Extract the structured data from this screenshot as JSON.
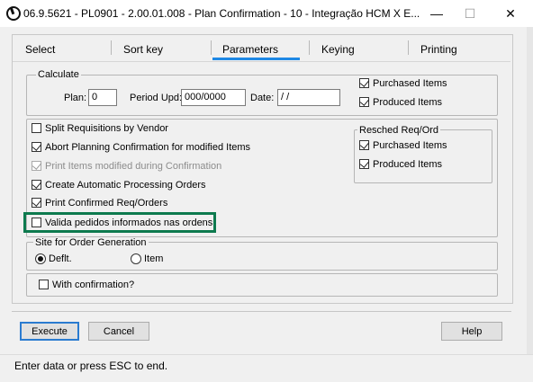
{
  "window": {
    "title": "06.9.5621 - PL0901 - 2.00.01.008 - Plan Confirmation - 10 - Integração HCM X E...",
    "minimize_glyph": "—",
    "maximize_glyph": "☐",
    "close_glyph": "✕"
  },
  "tabs": [
    {
      "label": "Select"
    },
    {
      "label": "Sort key"
    },
    {
      "label": "Parameters",
      "active": true
    },
    {
      "label": "Keying"
    },
    {
      "label": "Printing"
    }
  ],
  "calculate": {
    "legend": "Calculate",
    "plan_label": "Plan:",
    "plan_value": "0",
    "period_label": "Period Upd:",
    "period_value": "000/0000",
    "date_label": "Date:",
    "date_value": " / /",
    "purchased_items": {
      "label": "Purchased Items",
      "checked": true
    },
    "produced_items": {
      "label": "Produced Items",
      "checked": true
    }
  },
  "options": [
    {
      "label": "Split Requisitions by Vendor",
      "checked": false,
      "disabled": false
    },
    {
      "label": "Abort Planning Confirmation for modified Items",
      "checked": true,
      "disabled": false
    },
    {
      "label": "Print Items modified during Confirmation",
      "checked": true,
      "disabled": true
    },
    {
      "label": "Create Automatic Processing Orders",
      "checked": true,
      "disabled": false
    },
    {
      "label": "Print Confirmed Req/Orders",
      "checked": true,
      "disabled": false
    },
    {
      "label": "Valida pedidos informados nas ordens",
      "checked": false,
      "disabled": false,
      "highlighted": true
    }
  ],
  "resched": {
    "legend": "Resched Req/Ord",
    "purchased_items": {
      "label": "Purchased Items",
      "checked": true
    },
    "produced_items": {
      "label": "Produced Items",
      "checked": true
    }
  },
  "site": {
    "legend": "Site for Order Generation",
    "options": [
      {
        "label": "Deflt.",
        "selected": true
      },
      {
        "label": "Item",
        "selected": false
      }
    ]
  },
  "with_confirmation": {
    "label": "With confirmation?",
    "checked": false
  },
  "buttons": {
    "execute": "Execute",
    "cancel": "Cancel",
    "help": "Help"
  },
  "status": {
    "text": "Enter data or press ESC to end."
  },
  "colors": {
    "highlight_border": "#0d7a4e",
    "active_tab": "#1e88e5",
    "default_button": "#2a7bd0"
  }
}
